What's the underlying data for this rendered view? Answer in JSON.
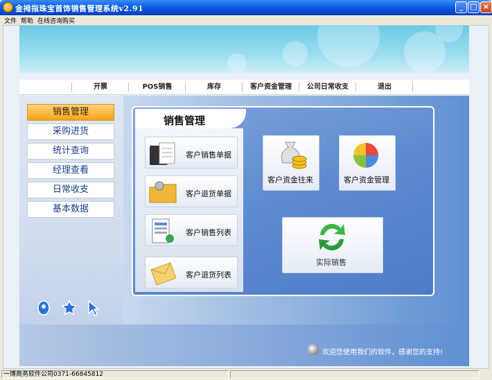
{
  "window": {
    "title": "金拇指珠宝首饰销售管理系统v2.91"
  },
  "menu": [
    "文件",
    "帮助",
    "在线咨询购买"
  ],
  "nav": [
    "开票",
    "POS销售",
    "库存",
    "客户资金管理",
    "公司日常收支",
    "退出"
  ],
  "sidebar": [
    "销售管理",
    "采购进货",
    "统计查询",
    "经理查看",
    "日常收支",
    "基本数据"
  ],
  "panel": {
    "title": "销售管理",
    "left_cards": [
      "客户销售单据",
      "客户退货单据",
      "客户销售列表",
      "客户退货列表"
    ],
    "right_cards": [
      "客户资金往来",
      "客户资金管理"
    ],
    "big_card": "实际销售"
  },
  "footer": {
    "message": "欢迎您使用我们的软件，感谢您的支持!"
  },
  "status": {
    "company": "一博商务软件公司0371-66845812"
  },
  "colors": {
    "titlebar": "#0a5ee0",
    "active_sidebar": "#f4a31d",
    "panel": "#5d8ad0"
  }
}
